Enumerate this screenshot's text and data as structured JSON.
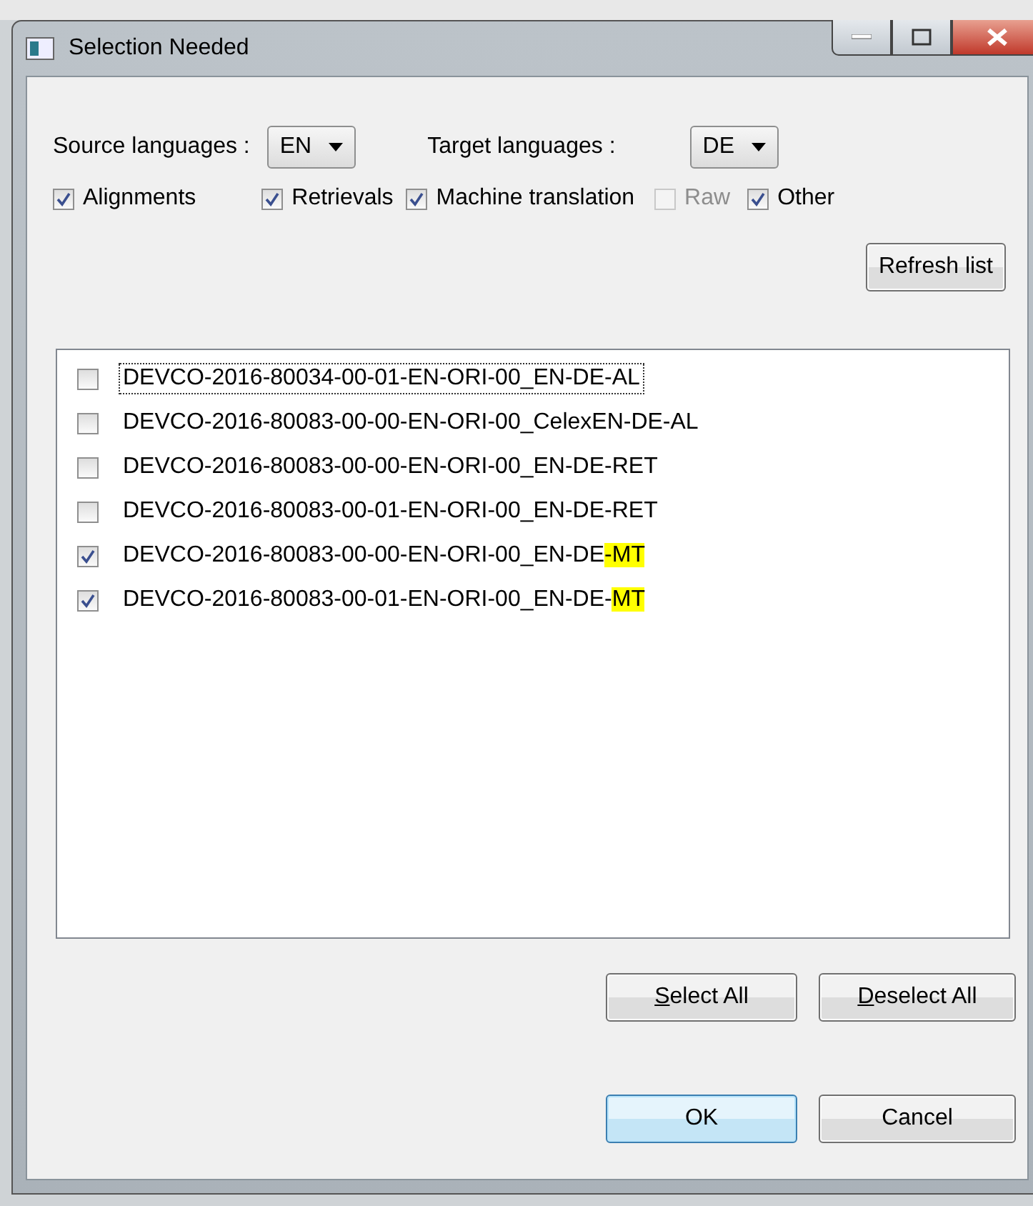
{
  "window": {
    "title": "Selection Needed"
  },
  "source": {
    "label": "Source languages :",
    "value": "EN"
  },
  "target": {
    "label": "Target languages :",
    "value": "DE"
  },
  "filters": [
    {
      "label": "Alignments",
      "checked": true,
      "disabled": false
    },
    {
      "label": "Retrievals",
      "checked": true,
      "disabled": false
    },
    {
      "label": "Machine translation",
      "checked": true,
      "disabled": false
    },
    {
      "label": "Raw",
      "checked": false,
      "disabled": true
    },
    {
      "label": "Other",
      "checked": true,
      "disabled": false
    }
  ],
  "refresh_button": "Refresh list",
  "files": [
    {
      "label": "DEVCO-2016-80034-00-01-EN-ORI-00_EN-DE-AL",
      "checked": false,
      "focused": true
    },
    {
      "label": "DEVCO-2016-80083-00-00-EN-ORI-00_CelexEN-DE-AL",
      "checked": false,
      "focused": false
    },
    {
      "label": "DEVCO-2016-80083-00-00-EN-ORI-00_EN-DE-RET",
      "checked": false,
      "focused": false
    },
    {
      "label": "DEVCO-2016-80083-00-01-EN-ORI-00_EN-DE-RET",
      "checked": false,
      "focused": false
    },
    {
      "label": "DEVCO-2016-80083-00-00-EN-ORI-00_EN-DE",
      "highlight": "-MT",
      "checked": true,
      "focused": false
    },
    {
      "label": "DEVCO-2016-80083-00-01-EN-ORI-00_EN-DE-",
      "highlight": "MT",
      "checked": true,
      "focused": false
    }
  ],
  "list_buttons": [
    {
      "key": "S",
      "rest": "elect All"
    },
    {
      "key": "D",
      "rest": "eselect All"
    }
  ],
  "dialog_buttons": [
    {
      "label": "OK",
      "default": true
    },
    {
      "label": "Cancel",
      "default": false
    }
  ]
}
